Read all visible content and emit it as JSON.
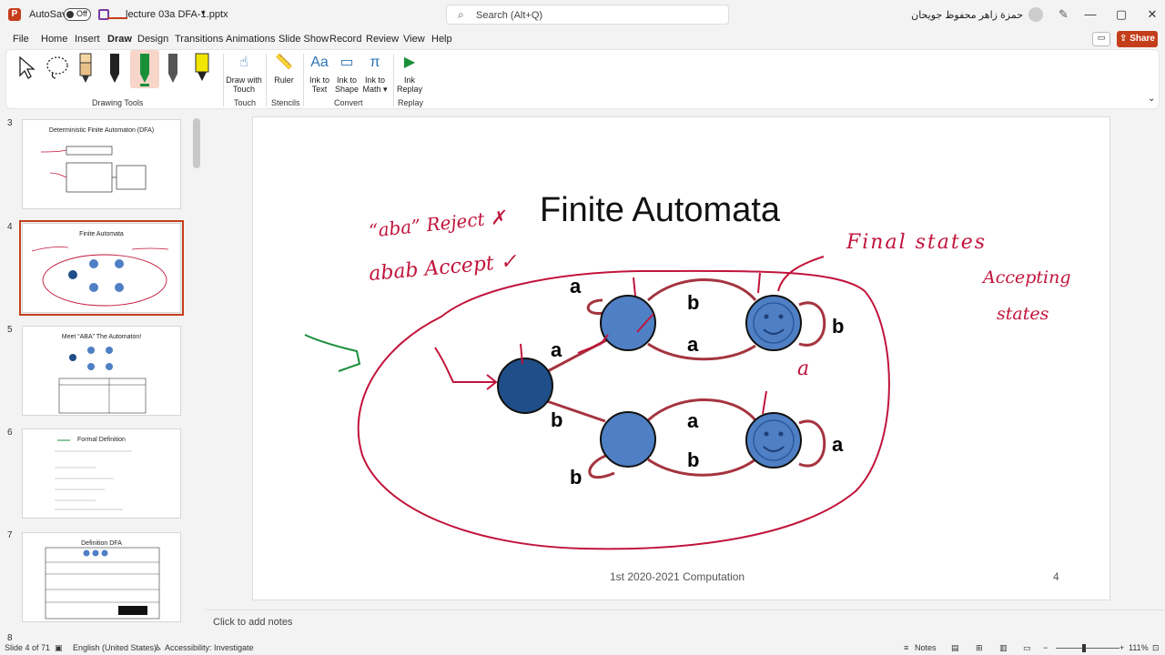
{
  "titlebar": {
    "app_logo": "P",
    "autosave_label": "AutoSave",
    "autosave_state": "Off",
    "document_title": "lecture 03a DFA-1.pptx",
    "search_placeholder": "Search (Alt+Q)",
    "user_name": "حمزة زاهر محفوظ جويحان"
  },
  "menu": {
    "items": [
      "File",
      "Home",
      "Insert",
      "Draw",
      "Design",
      "Transitions",
      "Animations",
      "Slide Show",
      "Record",
      "Review",
      "View",
      "Help"
    ],
    "active": "Draw",
    "share_label": "Share"
  },
  "ribbon": {
    "groups": [
      {
        "label": "Drawing Tools"
      },
      {
        "label": "Touch",
        "buttons": [
          "Draw with Touch"
        ]
      },
      {
        "label": "Stencils",
        "buttons": [
          "Ruler"
        ]
      },
      {
        "label": "Convert",
        "buttons": [
          "Ink to Text",
          "Ink to Shape",
          "Ink to Math"
        ]
      },
      {
        "label": "Replay",
        "buttons": [
          "Ink Replay"
        ]
      }
    ],
    "draw_with_touch_1": "Draw with",
    "draw_with_touch_2": "Touch",
    "ruler": "Ruler",
    "ink_to_text_1": "Ink to",
    "ink_to_text_2": "Text",
    "ink_to_shape_1": "Ink to",
    "ink_to_shape_2": "Shape",
    "ink_to_math_1": "Ink to",
    "ink_to_math_2": "Math",
    "ink_replay_1": "Ink",
    "ink_replay_2": "Replay",
    "group_drawing_tools": "Drawing Tools",
    "group_touch": "Touch",
    "group_stencils": "Stencils",
    "group_convert": "Convert",
    "group_replay": "Replay",
    "pen_colors": [
      "#222222",
      "#1a8f3a",
      "#555555",
      "#f2e500"
    ]
  },
  "thumbnails": [
    {
      "num": "3",
      "title": "Deterministic Finite Automaton (DFA)"
    },
    {
      "num": "4",
      "title": "Finite Automata",
      "selected": true
    },
    {
      "num": "5",
      "title": "Meet “ABA” The Automaton!"
    },
    {
      "num": "6",
      "title": "Formal Definition"
    },
    {
      "num": "7",
      "title": "Definition DFA"
    },
    {
      "num": "8",
      "title": ""
    }
  ],
  "slide": {
    "title": "Finite Automata",
    "footer": "1st 2020-2021  Computation",
    "number": "4",
    "edge_labels": {
      "e1": "a",
      "e2": "b",
      "e3": "a",
      "e4": "b",
      "e5": "a",
      "e6": "b",
      "e7": "a",
      "e8": "b",
      "e9": "b",
      "e10": "a"
    },
    "ink": {
      "reject": "“aba” Reject ✗",
      "accept": "abab Accept ✓",
      "final": "Final states",
      "accepting_1": "Accepting",
      "accepting_2": "states",
      "fa": "a"
    }
  },
  "notes": {
    "placeholder": "Click to add notes"
  },
  "status": {
    "slide_info": "Slide 4 of 71",
    "language": "English (United States)",
    "accessibility": "Accessibility: Investigate",
    "notes_btn": "Notes",
    "zoom": "111%"
  },
  "colors": {
    "accent": "#c43e1c",
    "state_blue": "#4f7fc4",
    "start_state": "#1f4e88",
    "ink_red": "#c1143b"
  }
}
